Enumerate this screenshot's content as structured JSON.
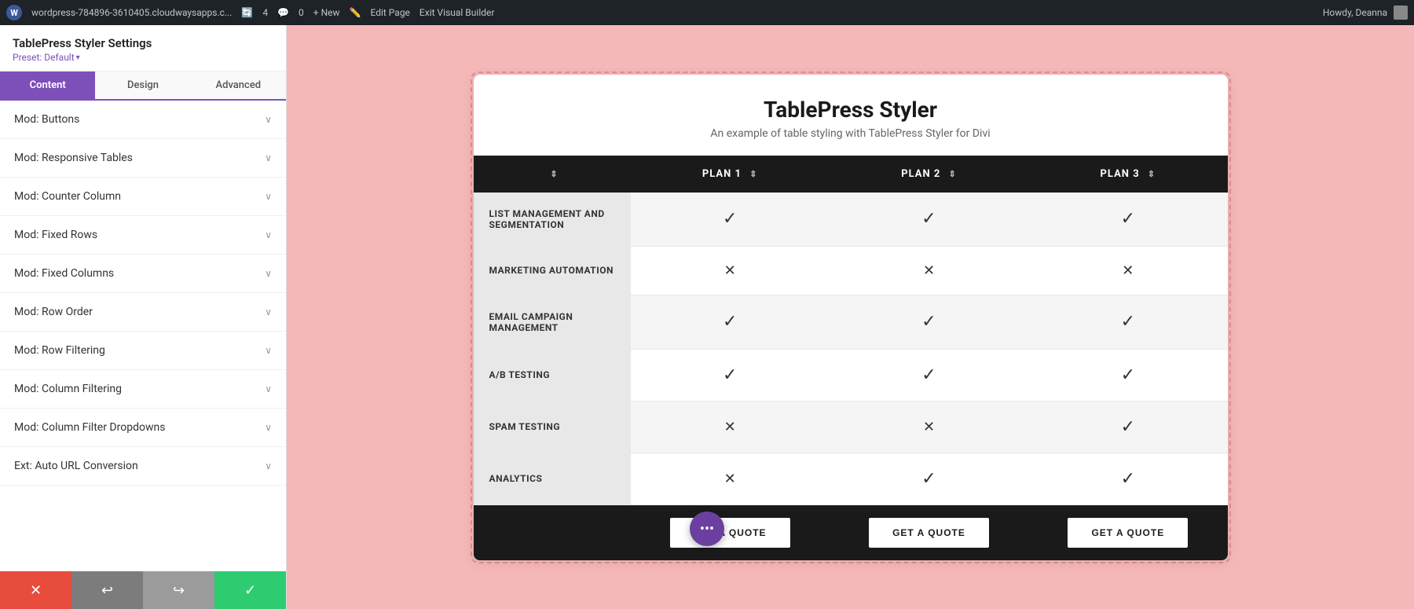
{
  "adminBar": {
    "logo": "W",
    "site": "wordpress-784896-3610405.cloudwaysapps.c...",
    "refreshCount": "4",
    "commentCount": "0",
    "new": "+ New",
    "editPage": "Edit Page",
    "exitVisualBuilder": "Exit Visual Builder",
    "howdy": "Howdy, Deanna"
  },
  "sidebar": {
    "title": "TablePress Styler Settings",
    "preset": "Preset: Default",
    "tabs": [
      {
        "label": "Content",
        "active": true
      },
      {
        "label": "Design",
        "active": false
      },
      {
        "label": "Advanced",
        "active": false
      }
    ],
    "items": [
      {
        "label": "Mod: Buttons"
      },
      {
        "label": "Mod: Responsive Tables"
      },
      {
        "label": "Mod: Counter Column"
      },
      {
        "label": "Mod: Fixed Rows"
      },
      {
        "label": "Mod: Fixed Columns"
      },
      {
        "label": "Mod: Row Order"
      },
      {
        "label": "Mod: Row Filtering"
      },
      {
        "label": "Mod: Column Filtering"
      },
      {
        "label": "Mod: Column Filter Dropdowns"
      },
      {
        "label": "Ext: Auto URL Conversion"
      }
    ]
  },
  "toolbar": {
    "cancel": "✕",
    "undo": "↩",
    "redo": "↪",
    "save": "✓"
  },
  "tableCard": {
    "title": "TablePress Styler",
    "subtitle": "An example of table styling with TablePress Styler for Divi",
    "headers": [
      "",
      "PLAN 1",
      "PLAN 2",
      "PLAN 3"
    ],
    "rows": [
      {
        "feature": "LIST MANAGEMENT AND SEGMENTATION",
        "plan1": "check",
        "plan2": "check",
        "plan3": "check"
      },
      {
        "feature": "MARKETING AUTOMATION",
        "plan1": "cross",
        "plan2": "cross",
        "plan3": "cross"
      },
      {
        "feature": "EMAIL CAMPAIGN MANAGEMENT",
        "plan1": "check",
        "plan2": "check",
        "plan3": "check"
      },
      {
        "feature": "A/B TESTING",
        "plan1": "check",
        "plan2": "check",
        "plan3": "check"
      },
      {
        "feature": "SPAM TESTING",
        "plan1": "cross",
        "plan2": "cross",
        "plan3": "check"
      },
      {
        "feature": "ANALYTICS",
        "plan1": "cross",
        "plan2": "check",
        "plan3": "check"
      }
    ],
    "footerBtn": "GET A QUOTE"
  },
  "fab": {
    "icon": "···"
  }
}
